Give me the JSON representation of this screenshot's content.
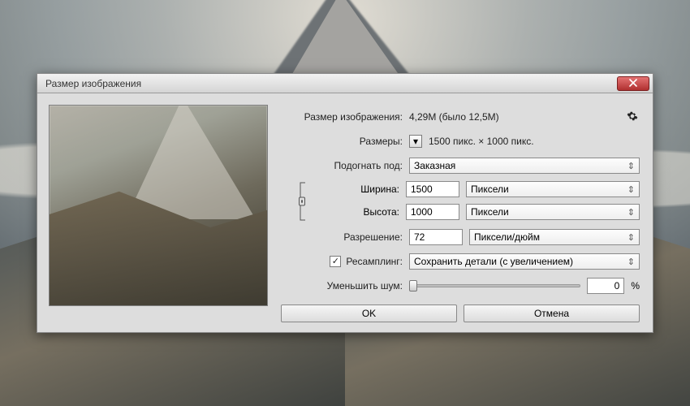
{
  "dialog": {
    "title": "Размер изображения",
    "size_label": "Размер изображения:",
    "size_value": "4,29M (было 12,5M)",
    "dims_label": "Размеры:",
    "dims_value": "1500 пикс.  ×  1000 пикс.",
    "fit_label": "Подогнать под:",
    "fit_value": "Заказная",
    "width_label": "Ширина:",
    "width_value": "1500",
    "width_unit": "Пиксели",
    "height_label": "Высота:",
    "height_value": "1000",
    "height_unit": "Пиксели",
    "res_label": "Разрешение:",
    "res_value": "72",
    "res_unit": "Пиксели/дюйм",
    "resample_label": "Ресамплинг:",
    "resample_value": "Сохранить детали (с увеличением)",
    "noise_label": "Уменьшить шум:",
    "noise_value": "0",
    "noise_suffix": "%",
    "ok": "OK",
    "cancel": "Отмена"
  }
}
